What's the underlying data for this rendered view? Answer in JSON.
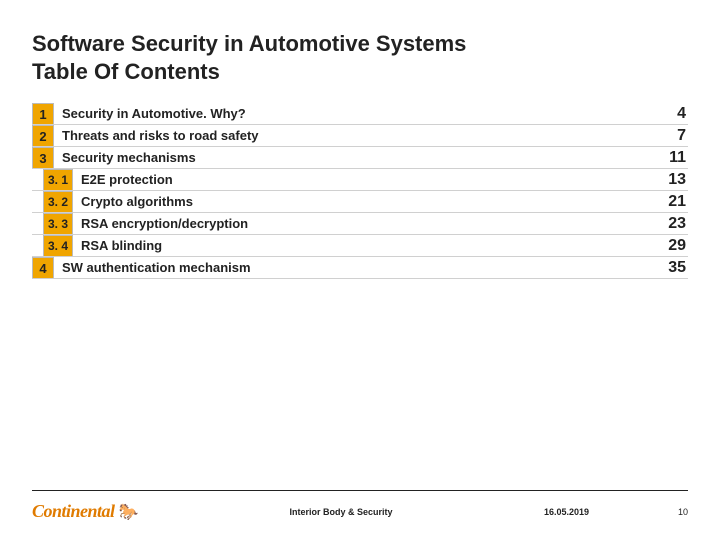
{
  "title": {
    "line1": "Software Security in Automotive Systems",
    "line2": "Table Of Contents"
  },
  "toc": [
    {
      "num": "1",
      "level": 0,
      "label": "Security in Automotive. Why?",
      "page": "4"
    },
    {
      "num": "2",
      "level": 0,
      "label": "Threats and risks to road safety",
      "page": "7"
    },
    {
      "num": "3",
      "level": 0,
      "label": "Security mechanisms",
      "page": "11"
    },
    {
      "num": "3. 1",
      "level": 1,
      "label": "E2E protection",
      "page": "13"
    },
    {
      "num": "3. 2",
      "level": 1,
      "label": "Crypto algorithms",
      "page": "21"
    },
    {
      "num": "3. 3",
      "level": 1,
      "label": "RSA encryption/decryption",
      "page": "23"
    },
    {
      "num": "3. 4",
      "level": 1,
      "label": "RSA blinding",
      "page": "29"
    },
    {
      "num": "4",
      "level": 0,
      "label": "SW authentication mechanism",
      "page": "35"
    }
  ],
  "footer": {
    "logo_text": "Continental",
    "horse_glyph": "🐎",
    "center": "Interior Body & Security",
    "date": "16.05.2019",
    "page": "10"
  }
}
